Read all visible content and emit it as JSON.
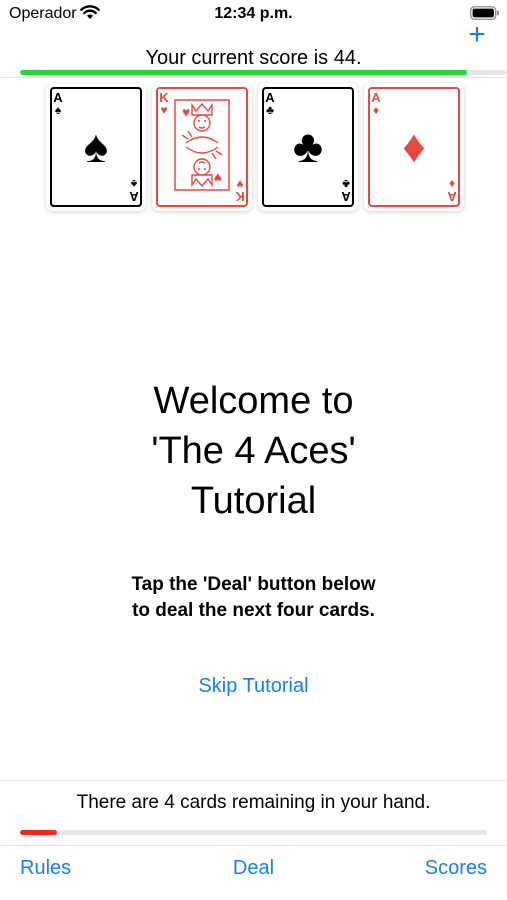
{
  "status_bar": {
    "carrier": "Operador",
    "time": "12:34 p.m."
  },
  "nav": {
    "add_label": "+"
  },
  "score": {
    "text": "Your current score is 44.",
    "progress_fraction": 0.92,
    "progress_color": "#2bd53b"
  },
  "cards": [
    {
      "rank": "A",
      "suit": "♠",
      "color": "black",
      "name": "ace-of-spades"
    },
    {
      "rank": "K",
      "suit": "♥",
      "color": "red",
      "name": "king-of-hearts"
    },
    {
      "rank": "A",
      "suit": "♣",
      "color": "black",
      "name": "ace-of-clubs"
    },
    {
      "rank": "A",
      "suit": "♦",
      "color": "red",
      "name": "ace-of-diamonds"
    }
  ],
  "welcome": {
    "line1": "Welcome to",
    "line2": "'The 4 Aces'",
    "line3": "Tutorial"
  },
  "instruction": {
    "line1": "Tap the 'Deal' button below",
    "line2": "to deal the next four cards."
  },
  "skip_label": "Skip Tutorial",
  "hand": {
    "text": "There are 4 cards remaining in your hand.",
    "progress_fraction": 0.08,
    "progress_color": "#f0291e"
  },
  "toolbar": {
    "rules": "Rules",
    "deal": "Deal",
    "scores": "Scores"
  },
  "colors": {
    "accent": "#147efb",
    "card_red": "#e8483f"
  }
}
